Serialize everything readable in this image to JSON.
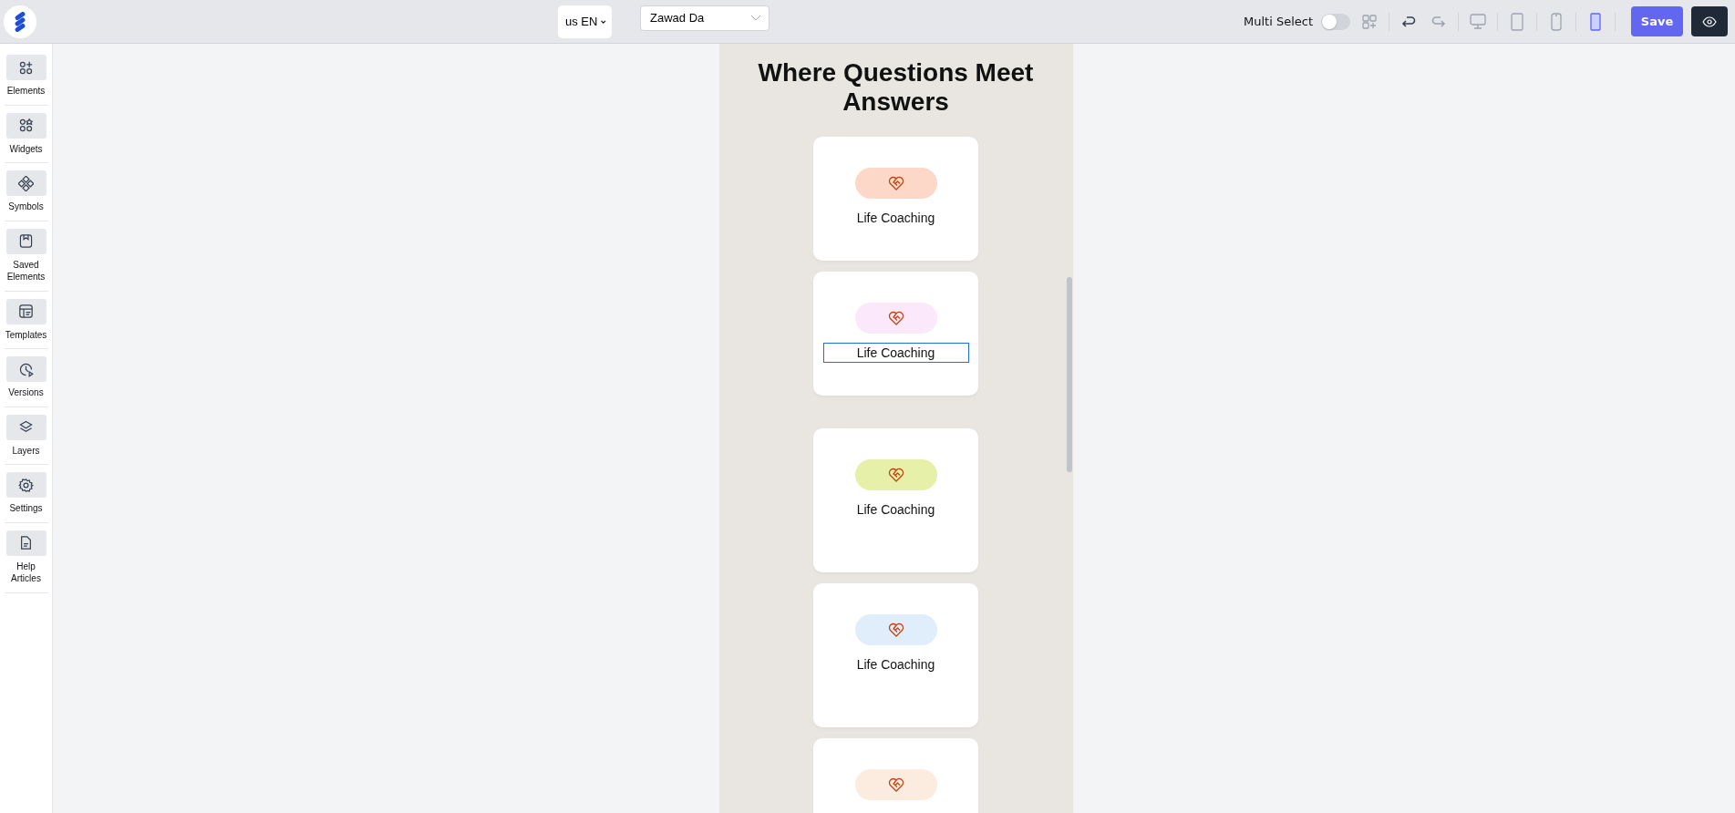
{
  "top_bar": {
    "language": "us EN",
    "user": "Zawad Da",
    "multi_select": {
      "label": "Multi Select",
      "on": false
    },
    "undo": {
      "disabled": false
    },
    "redo": {
      "disabled": true
    },
    "devices": [
      {
        "kind": "desktop",
        "selected": false
      },
      {
        "kind": "tablet",
        "selected": false
      },
      {
        "kind": "phone",
        "selected": false
      },
      {
        "kind": "mobile",
        "selected": true
      }
    ],
    "save": "Save"
  },
  "sidebar": {
    "items": [
      {
        "kind": "elements",
        "label": "Elements"
      },
      {
        "kind": "widgets",
        "label": "Widgets"
      },
      {
        "kind": "symbols",
        "label": "Symbols"
      },
      {
        "kind": "saved",
        "label": "Saved Elements"
      },
      {
        "kind": "templates",
        "label": "Templates"
      },
      {
        "kind": "versions",
        "label": "Versions"
      },
      {
        "kind": "layers",
        "label": "Layers"
      },
      {
        "kind": "settings",
        "label": "Settings"
      },
      {
        "kind": "help",
        "label": "Help Articles"
      }
    ]
  },
  "preview": {
    "heading": "Where Questions Meet Answers",
    "cards": [
      {
        "label": "Life Coaching",
        "color": "#fdd8c8",
        "selected": false,
        "tall": false
      },
      {
        "label": "Life Coaching",
        "color": "#fbe9fb",
        "selected": true,
        "tall": false
      },
      {
        "label": "Life Coaching",
        "color": "#e6f0a8",
        "selected": false,
        "tall": true
      },
      {
        "label": "Life Coaching",
        "color": "#e0edfb",
        "selected": false,
        "tall": true
      },
      {
        "color": "#fcece0",
        "selected": false
      }
    ]
  }
}
